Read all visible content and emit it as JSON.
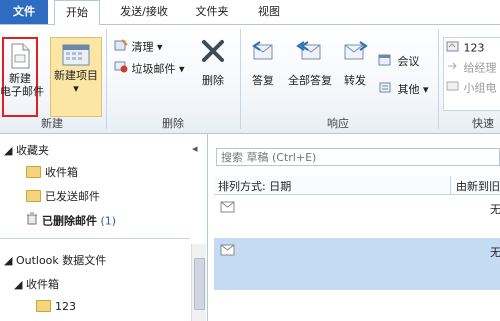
{
  "ribbon_tabs": {
    "file": "文件",
    "home": "开始",
    "send_receive": "发送/接收",
    "folder": "文件夹",
    "view": "视图"
  },
  "groups": {
    "new": {
      "label": "新建",
      "new_email_line1": "新建",
      "new_email_line2": "电子邮件",
      "new_items": "新建项目",
      "new_items_arrow": "▾"
    },
    "delete": {
      "label": "删除",
      "clean_up": "清理 ▾",
      "junk": "垃圾邮件 ▾",
      "delete": "删除"
    },
    "respond": {
      "label": "响应",
      "reply": "答复",
      "reply_all": "全部答复",
      "forward": "转发",
      "meeting": "会议",
      "more": "其他 ▾"
    },
    "quick_steps": {
      "label": "快速",
      "item1": "123",
      "item2": "给经理",
      "item3": "小组电"
    }
  },
  "nav": {
    "collapse": "◂",
    "favorites": "◢ 收藏夹",
    "fav_inbox": "收件箱",
    "fav_sent": "已发送邮件",
    "fav_deleted": "已删除邮件",
    "fav_deleted_count": "(1)",
    "data_file": "◢ Outlook 数据文件",
    "df_inbox": "◢ 收件箱",
    "df_123": "123"
  },
  "list": {
    "search_placeholder": "搜索 草稿 (Ctrl+E)",
    "sort_label": "排列方式: 日期",
    "order_label": "由新到旧",
    "row1_right": "无",
    "row2_right": "无"
  },
  "colors": {
    "file_tab": "#2e6cc2",
    "highlight_box": "#e02020",
    "selected_row": "#c5dbf4",
    "folder": "#f5d57b"
  }
}
